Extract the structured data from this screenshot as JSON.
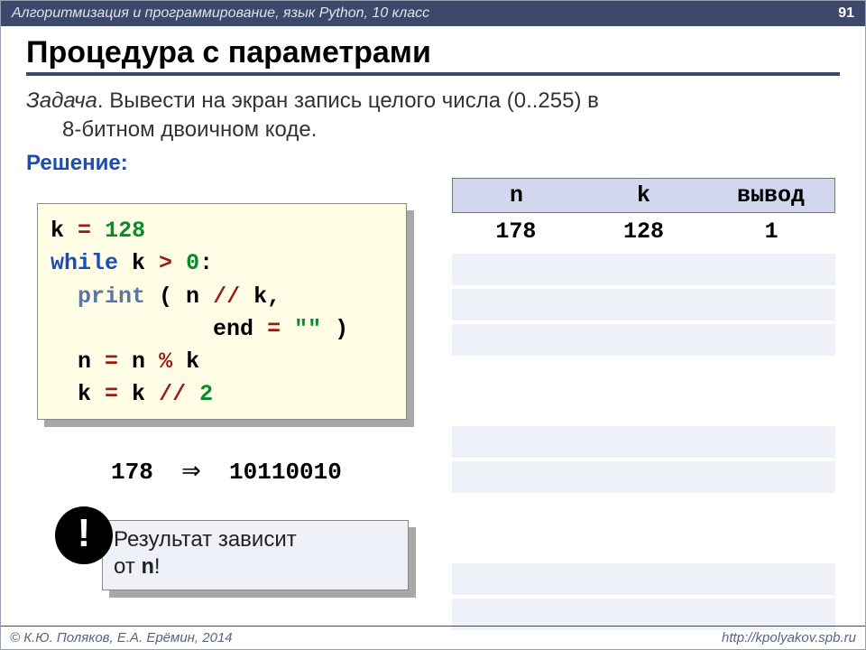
{
  "header": {
    "breadcrumb": "Алгоритмизация и программирование, язык Python, 10 класс",
    "page_number": "91"
  },
  "title": "Процедура с параметрами",
  "task": {
    "lead": "Задача",
    "text1": ". Вывести на экран запись целого числа (0..255) в",
    "text2": "8-битном двоичном коде."
  },
  "solve_label": "Решение:",
  "code": {
    "l1a": "k",
    "l1b": "=",
    "l1c": "128",
    "l2a": "while",
    "l2b": " k",
    "l2c": ">",
    "l2d": "0",
    "l2e": ":",
    "l3a": "print",
    "l3b": " ( n",
    "l3c": "//",
    "l3d": " k,",
    "l4a": "end",
    "l4b": "=",
    "l4c": "\"\"",
    "l4d": " )",
    "l5a": "  n",
    "l5b": "=",
    "l5c": " n",
    "l5d": "%",
    "l5e": " k",
    "l6a": "  k",
    "l6b": "=",
    "l6c": " k",
    "l6d": "//",
    "l6e": "2"
  },
  "example": {
    "n": "178",
    "arrow": "⇒",
    "bin": "10110010"
  },
  "note": {
    "text1": "Результат зависит",
    "text2": "от ",
    "var": "n",
    "bang": "!"
  },
  "badge": "!",
  "trace": {
    "headers": [
      "n",
      "k",
      "вывод"
    ],
    "row": [
      "178",
      "128",
      "1"
    ]
  },
  "footer": {
    "left": "© К.Ю. Поляков, Е.А. Ерёмин, 2014",
    "right": "http://kpolyakov.spb.ru"
  }
}
